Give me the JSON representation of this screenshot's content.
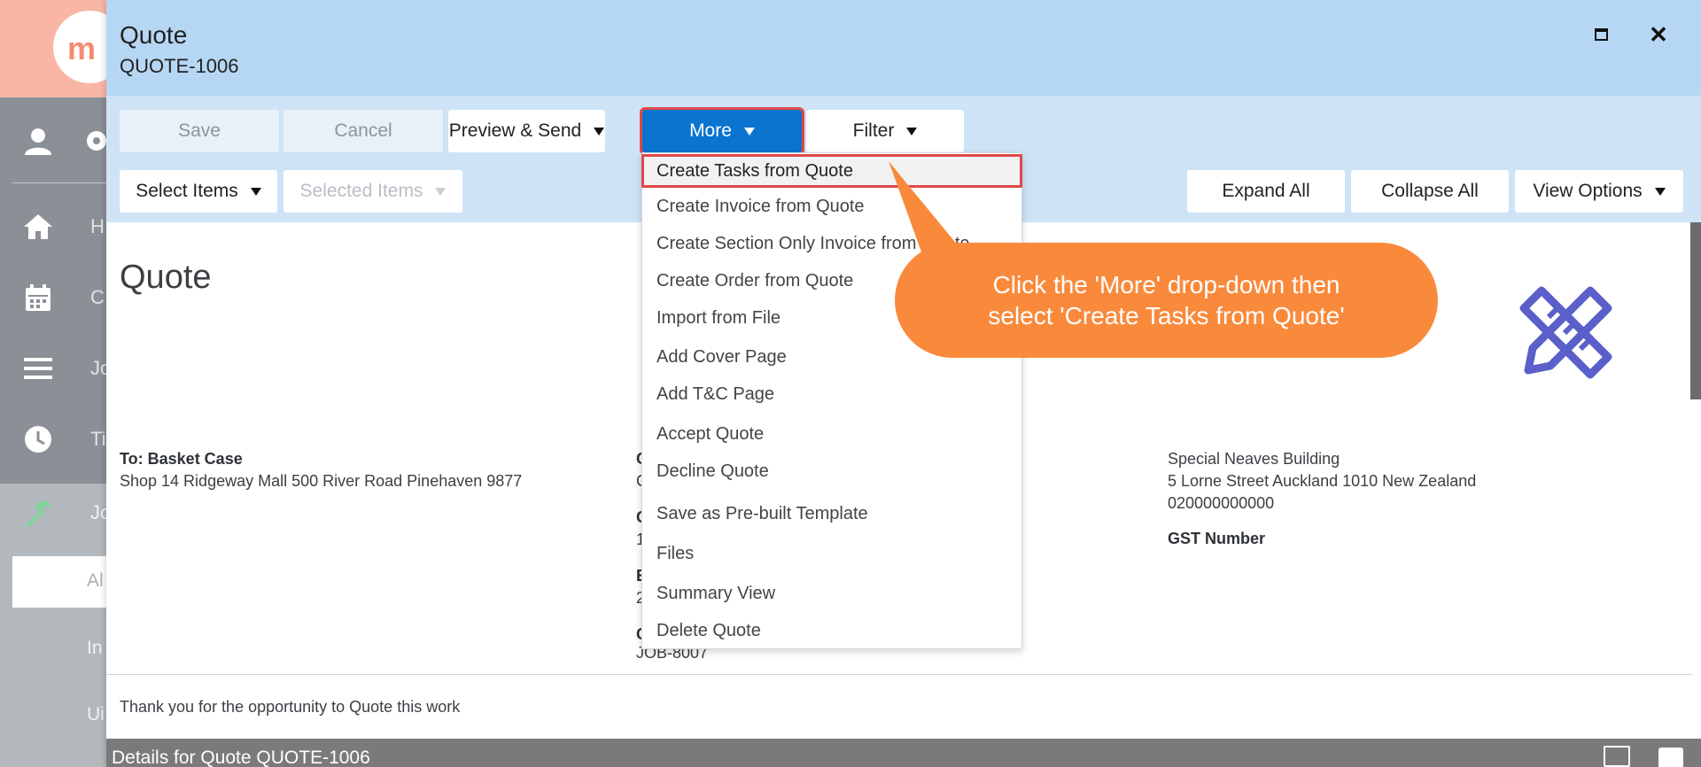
{
  "sidebar": {
    "logo_text": "m",
    "nav_labels": [
      "H",
      "C",
      "Jo",
      "Ti",
      "Jo"
    ],
    "sub_active": "Al",
    "sub_items": [
      "In",
      "Ui"
    ]
  },
  "modal": {
    "title": "Quote",
    "subtitle": "QUOTE-1006"
  },
  "toolbar": {
    "save": "Save",
    "cancel": "Cancel",
    "preview_send": "Preview & Send",
    "more": "More",
    "filter": "Filter",
    "select_items": "Select Items",
    "selected_items": "Selected Items",
    "expand_all": "Expand All",
    "collapse_all": "Collapse All",
    "view_options": "View Options"
  },
  "more_menu": {
    "items": [
      "Create Tasks from Quote",
      "Create Invoice from Quote",
      "Create Section Only Invoice from Quote",
      "Create Order from Quote",
      "Import from File",
      "Add Cover Page",
      "Add T&C Page",
      "Accept Quote",
      "Decline Quote",
      "Save as Pre-built Template",
      "Files",
      "Summary View",
      "Delete Quote"
    ]
  },
  "document": {
    "heading": "Quote",
    "to_label": "To: Basket Case",
    "to_address": "Shop 14 Ridgeway Mall 500 River Road Pinehaven 9877",
    "mid_col_letters": [
      "C",
      "C",
      "C",
      "1",
      "E",
      "2",
      "C"
    ],
    "job_ref": "JOB-8007",
    "company_name": "Special Neaves Building",
    "company_address": "5 Lorne Street Auckland 1010 New Zealand",
    "company_phone": "020000000000",
    "gst_label": "GST Number",
    "thanks": "Thank you for the opportunity to Quote this work"
  },
  "details_bar": {
    "label": "Details for Quote QUOTE-1006"
  },
  "callout": {
    "line1": "Click the 'More' drop-down then",
    "line2": "select 'Create Tasks from Quote'"
  },
  "colors": {
    "accent_blue": "#0a74cf",
    "highlight_red": "#e04848",
    "callout_orange": "#f98a3c",
    "header_blue": "#b6d7f3"
  }
}
